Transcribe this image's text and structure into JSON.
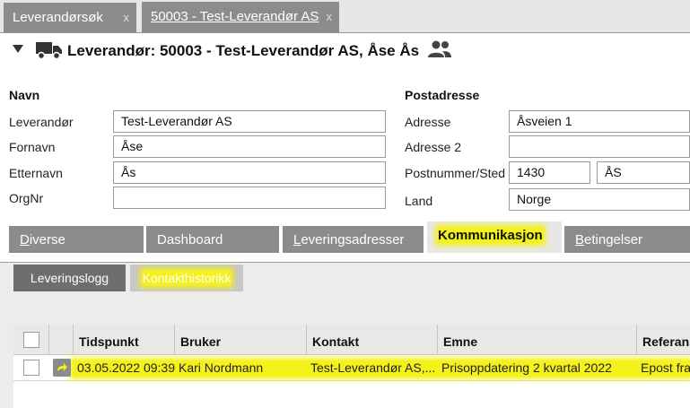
{
  "tabs": [
    {
      "label": "Leverandørsøk",
      "close": "x"
    },
    {
      "label": "50003 - Test-Leverandør AS",
      "close": "x"
    }
  ],
  "header": {
    "title": "Leverandør: 50003 - Test-Leverandør AS, Åse Ås"
  },
  "form": {
    "left_section": "Navn",
    "right_section": "Postadresse",
    "labels": {
      "leverandor": "Leverandør",
      "fornavn": "Fornavn",
      "etternavn": "Etternavn",
      "orgnr": "OrgNr",
      "adresse": "Adresse",
      "adresse2": "Adresse 2",
      "postnr": "Postnummer/Sted",
      "land": "Land"
    },
    "values": {
      "leverandor": "Test-Leverandør AS",
      "fornavn": "Åse",
      "etternavn": "Ås",
      "orgnr": "",
      "adresse": "Åsveien 1",
      "adresse2": "",
      "postnr": "1430",
      "sted": "ÅS",
      "land": "Norge"
    }
  },
  "section_tabs": [
    {
      "first": "D",
      "rest": "iverse"
    },
    {
      "first": "",
      "rest": "Dashboard"
    },
    {
      "first": "L",
      "rest": "everingsadresser"
    },
    {
      "first": "",
      "rest": "Kommunikasjon"
    },
    {
      "first": "B",
      "rest": "etingelser"
    }
  ],
  "sub_tabs": [
    "Leveringslogg",
    "Kontakthistorikk"
  ],
  "grid": {
    "columns": [
      "Tidspunkt",
      "Bruker",
      "Kontakt",
      "Emne",
      "Referanse"
    ],
    "rows": [
      [
        "03.05.2022 09:39",
        "Kari Nordmann",
        "Test-Leverandør AS,...",
        "Prisoppdatering 2 kvartal 2022",
        "Epost fra"
      ]
    ]
  },
  "colors": {
    "highlight": "#f4f21a",
    "tab_bg": "#8c8c8c"
  },
  "icons": [
    "close-icon",
    "collapse-caret-icon",
    "truck-icon",
    "people-icon",
    "row-action-icon"
  ]
}
